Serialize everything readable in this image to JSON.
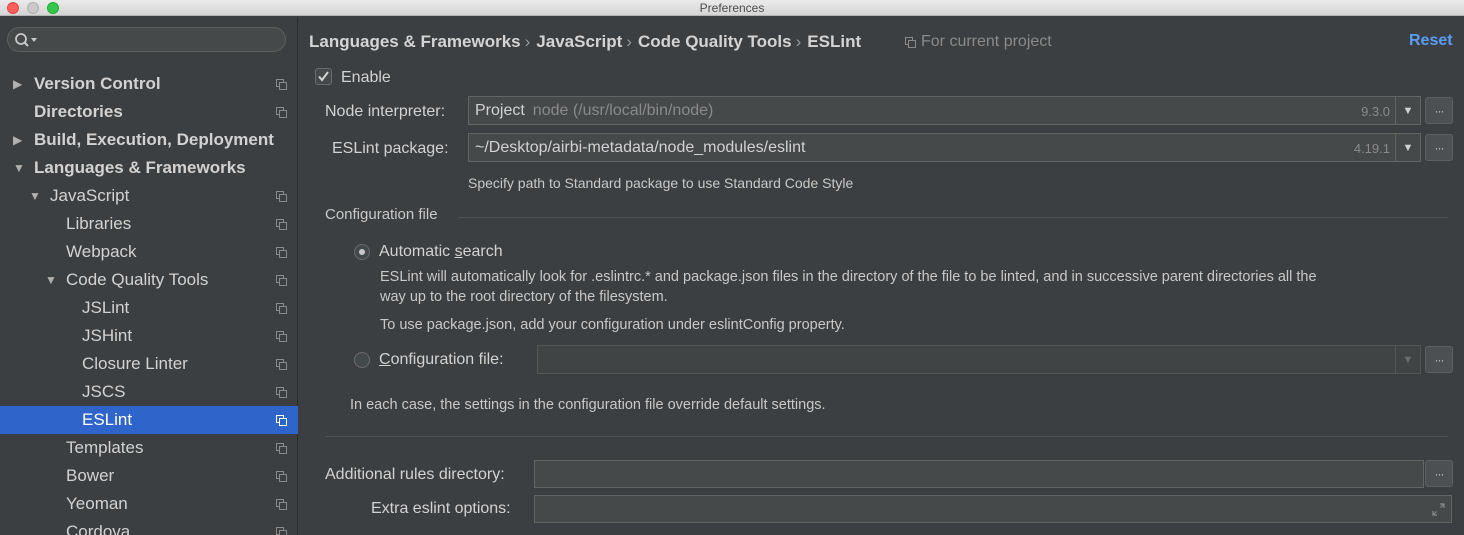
{
  "window": {
    "title": "Preferences"
  },
  "sidebar": {
    "search_placeholder": "",
    "items": [
      {
        "label": "Version Control",
        "arrow": "▶"
      },
      {
        "label": "Directories",
        "arrow": ""
      },
      {
        "label": "Build, Execution, Deployment",
        "arrow": "▶"
      },
      {
        "label": "Languages & Frameworks",
        "arrow": "▼"
      },
      {
        "label": "JavaScript",
        "arrow": "▼"
      },
      {
        "label": "Libraries",
        "arrow": ""
      },
      {
        "label": "Webpack",
        "arrow": ""
      },
      {
        "label": "Code Quality Tools",
        "arrow": "▼"
      },
      {
        "label": "JSLint",
        "arrow": ""
      },
      {
        "label": "JSHint",
        "arrow": ""
      },
      {
        "label": "Closure Linter",
        "arrow": ""
      },
      {
        "label": "JSCS",
        "arrow": ""
      },
      {
        "label": "ESLint",
        "arrow": ""
      },
      {
        "label": "Templates",
        "arrow": ""
      },
      {
        "label": "Bower",
        "arrow": ""
      },
      {
        "label": "Yeoman",
        "arrow": ""
      },
      {
        "label": "Cordova",
        "arrow": ""
      }
    ]
  },
  "header": {
    "breadcrumb": [
      "Languages & Frameworks",
      "JavaScript",
      "Code Quality Tools",
      "ESLint"
    ],
    "separator": "›",
    "for_project": "For current project",
    "reset": "Reset"
  },
  "form": {
    "enable_label": "Enable",
    "node_interpreter": {
      "label": "Node interpreter:",
      "value": "Project",
      "path": "node (/usr/local/bin/node)",
      "version": "9.3.0"
    },
    "eslint_package": {
      "label": "ESLint package:",
      "value": "~/Desktop/airbi-metadata/node_modules/eslint",
      "version": "4.19.1",
      "hint": "Specify path to Standard package to use Standard Code Style"
    },
    "configuration": {
      "title": "Configuration file",
      "automatic_label_pre": "Automatic ",
      "automatic_label_u": "s",
      "automatic_label_post": "earch",
      "automatic_desc_line1": "ESLint will automatically look for .eslintrc.* and package.json files in the directory of the file to be linted, and in successive parent directories all the",
      "automatic_desc_line2": "way up to the root directory of the filesystem.",
      "automatic_desc_line3": "To use package.json, add your configuration under eslintConfig property.",
      "config_file_label_u": "C",
      "config_file_label_post": "onfiguration file:",
      "config_file_value": "",
      "note": "In each case, the settings in the configuration file override default settings."
    },
    "additional_rules_label": "Additional rules directory:",
    "additional_rules_value": "",
    "extra_options_label": "Extra eslint options:",
    "extra_options_value": "",
    "more_button": "···",
    "dropdown_arrow": "▼"
  },
  "colors": {
    "background": "#3c3f41",
    "selection": "#2f65ca",
    "link": "#589df6"
  }
}
